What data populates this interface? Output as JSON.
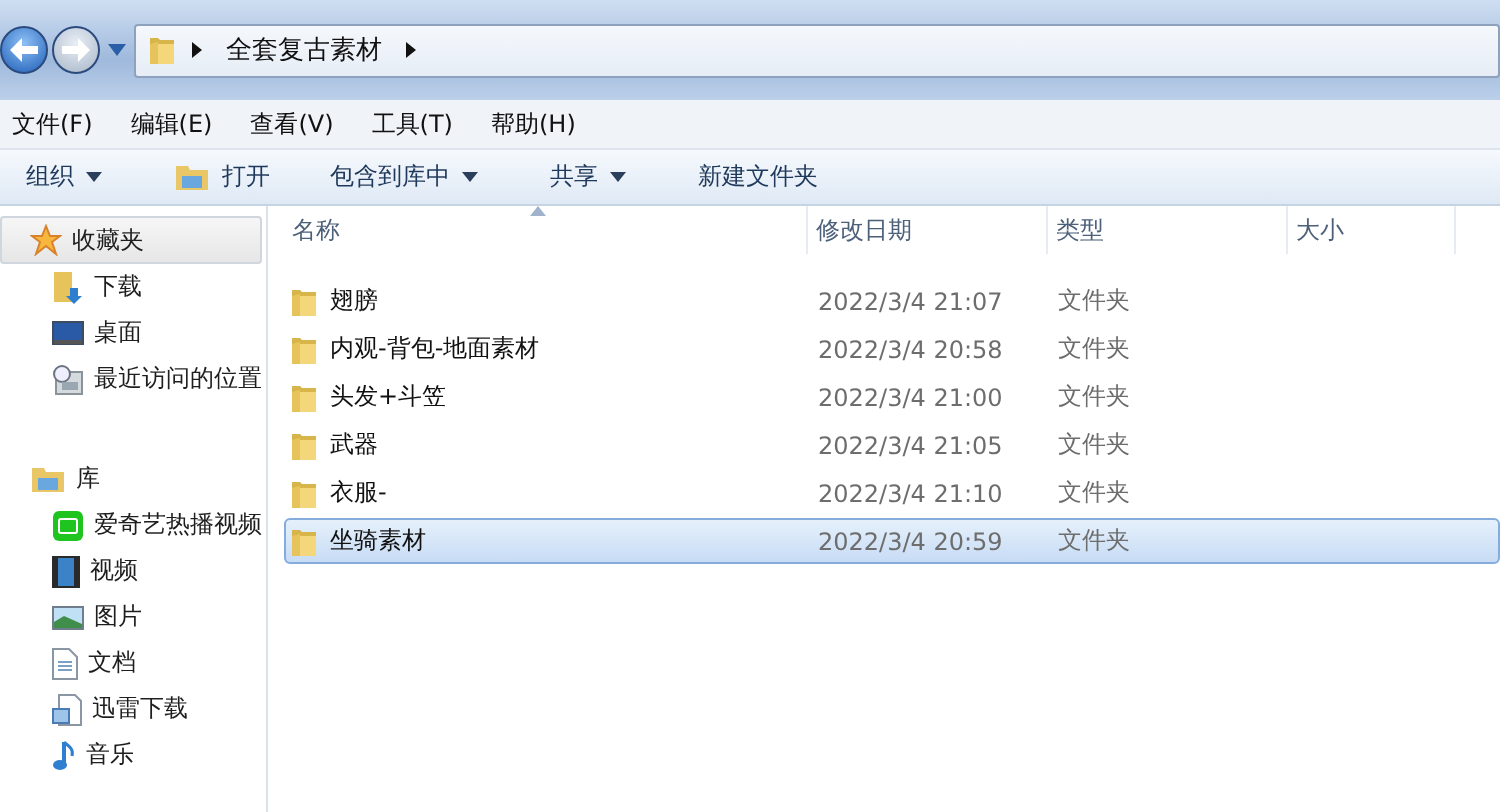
{
  "address_bar": {
    "path": [
      {
        "label": "全套复古素材"
      }
    ]
  },
  "menu_bar": [
    "文件(F)",
    "编辑(E)",
    "查看(V)",
    "工具(T)",
    "帮助(H)"
  ],
  "toolbar": [
    {
      "label": "组织",
      "kind": "dropdown"
    },
    {
      "label": "打开",
      "kind": "icon"
    },
    {
      "label": "包含到库中",
      "kind": "dropdown"
    },
    {
      "label": "共享",
      "kind": "dropdown"
    },
    {
      "label": "新建文件夹",
      "kind": "plain"
    }
  ],
  "sidebar": {
    "sections": [
      {
        "label": "收藏夹",
        "kind": "star",
        "selected": true,
        "children": [
          {
            "label": "下载",
            "kind": "download"
          },
          {
            "label": "桌面",
            "kind": "desktop"
          },
          {
            "label": "最近访问的位置",
            "kind": "recent"
          }
        ]
      },
      {
        "label": "库",
        "kind": "library",
        "selected": false,
        "children": [
          {
            "label": "爱奇艺热播视频",
            "kind": "iqiyi"
          },
          {
            "label": "视频",
            "kind": "video"
          },
          {
            "label": "图片",
            "kind": "picture"
          },
          {
            "label": "文档",
            "kind": "document"
          },
          {
            "label": "迅雷下载",
            "kind": "thunder"
          },
          {
            "label": "音乐",
            "kind": "music"
          }
        ]
      }
    ]
  },
  "table": {
    "columns": [
      "名称",
      "修改日期",
      "类型",
      "大小"
    ],
    "rows": [
      {
        "name": "翅膀",
        "modified": "2022/3/4 21:07",
        "type": "文件夹",
        "selected": false
      },
      {
        "name": "内观-背包-地面素材",
        "modified": "2022/3/4 20:58",
        "type": "文件夹",
        "selected": false
      },
      {
        "name": "头发+斗笠",
        "modified": "2022/3/4 21:00",
        "type": "文件夹",
        "selected": false
      },
      {
        "name": "武器",
        "modified": "2022/3/4 21:05",
        "type": "文件夹",
        "selected": false
      },
      {
        "name": "衣服-",
        "modified": "2022/3/4 21:10",
        "type": "文件夹",
        "selected": false
      },
      {
        "name": "坐骑素材",
        "modified": "2022/3/4 20:59",
        "type": "文件夹",
        "selected": true
      }
    ]
  }
}
